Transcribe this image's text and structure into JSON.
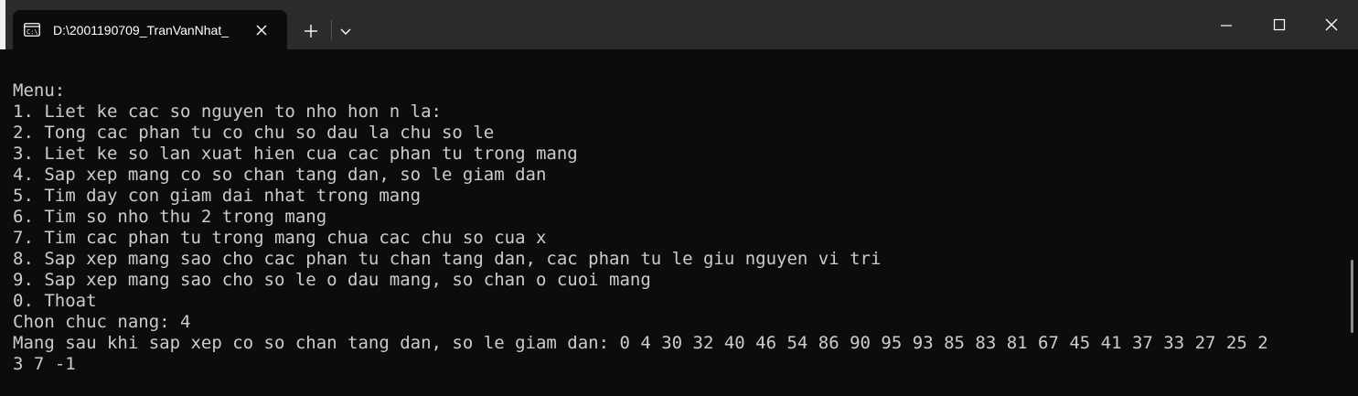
{
  "window": {
    "tab_title": "D:\\2001190709_TranVanNhat_",
    "tab_icon": "terminal-icon",
    "new_tab_icon": "plus-icon",
    "dropdown_icon": "chevron-down-icon",
    "controls": [
      "minimize-icon",
      "maximize-icon",
      "close-icon"
    ]
  },
  "console": {
    "lines": [
      "Menu:",
      "1. Liet ke cac so nguyen to nho hon n la:",
      "2. Tong cac phan tu co chu so dau la chu so le",
      "3. Liet ke so lan xuat hien cua cac phan tu trong mang",
      "4. Sap xep mang co so chan tang dan, so le giam dan",
      "5. Tim day con giam dai nhat trong mang",
      "6. Tim so nho thu 2 trong mang",
      "7. Tim cac phan tu trong mang chua cac chu so cua x",
      "8. Sap xep mang sao cho cac phan tu chan tang dan, cac phan tu le giu nguyen vi tri",
      "9. Sap xep mang sao cho so le o dau mang, so chan o cuoi mang",
      "0. Thoat",
      "Chon chuc nang: 4",
      "Mang sau khi sap xep co so chan tang dan, so le giam dan: 0 4 30 32 40 46 54 86 90 95 93 85 83 81 67 45 41 37 33 27 25 2",
      "3 7 -1"
    ]
  },
  "colors": {
    "titlebar": "#2b2b2b",
    "tab_active": "#0c0c0c",
    "console_bg": "#0c0c0c",
    "console_text": "#cccccc"
  }
}
